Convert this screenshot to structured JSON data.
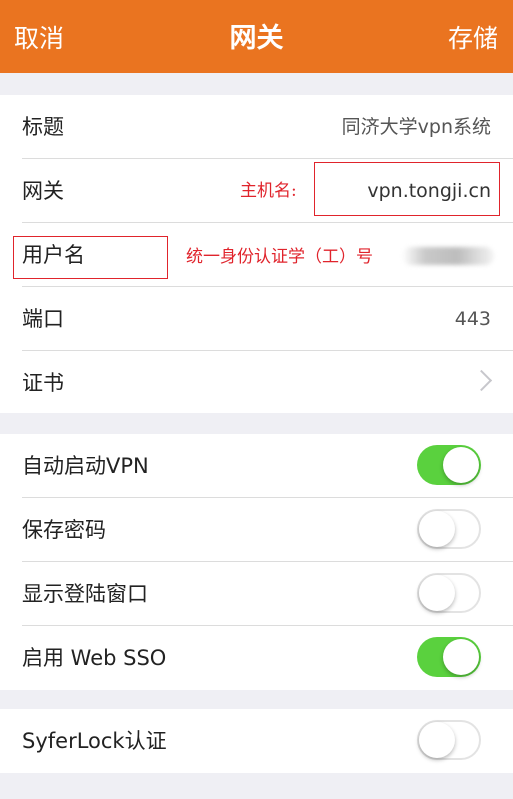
{
  "navbar": {
    "cancel_label": "取消",
    "title": "网关",
    "save_label": "存储"
  },
  "gateway_section": {
    "rows": [
      {
        "label": "标题",
        "value": "同济大学vpn系统"
      },
      {
        "label": "网关",
        "value": "vpn.tongji.cn"
      },
      {
        "label": "用户名",
        "value": ""
      },
      {
        "label": "端口",
        "value": "443"
      },
      {
        "label": "证书",
        "value": ""
      }
    ]
  },
  "options_section": {
    "rows": [
      {
        "label": "自动启动VPN",
        "state": "on"
      },
      {
        "label": "保存密码",
        "state": "off"
      },
      {
        "label": "显示登陆窗口",
        "state": "off"
      },
      {
        "label": "启用 Web SSO",
        "state": "on"
      }
    ]
  },
  "syferlock_section": {
    "label": "SyferLock认证",
    "state": "off"
  },
  "annotations": {
    "hostname_note": "主机名:",
    "username_note": "统一身份认证学（工）号"
  },
  "colors": {
    "navbar": "#ea7420",
    "toggle_on": "#5ad13e",
    "annotation": "#e0242c",
    "background": "#efeff4"
  },
  "icons": {
    "certificate_row": "chevron-right-icon"
  }
}
